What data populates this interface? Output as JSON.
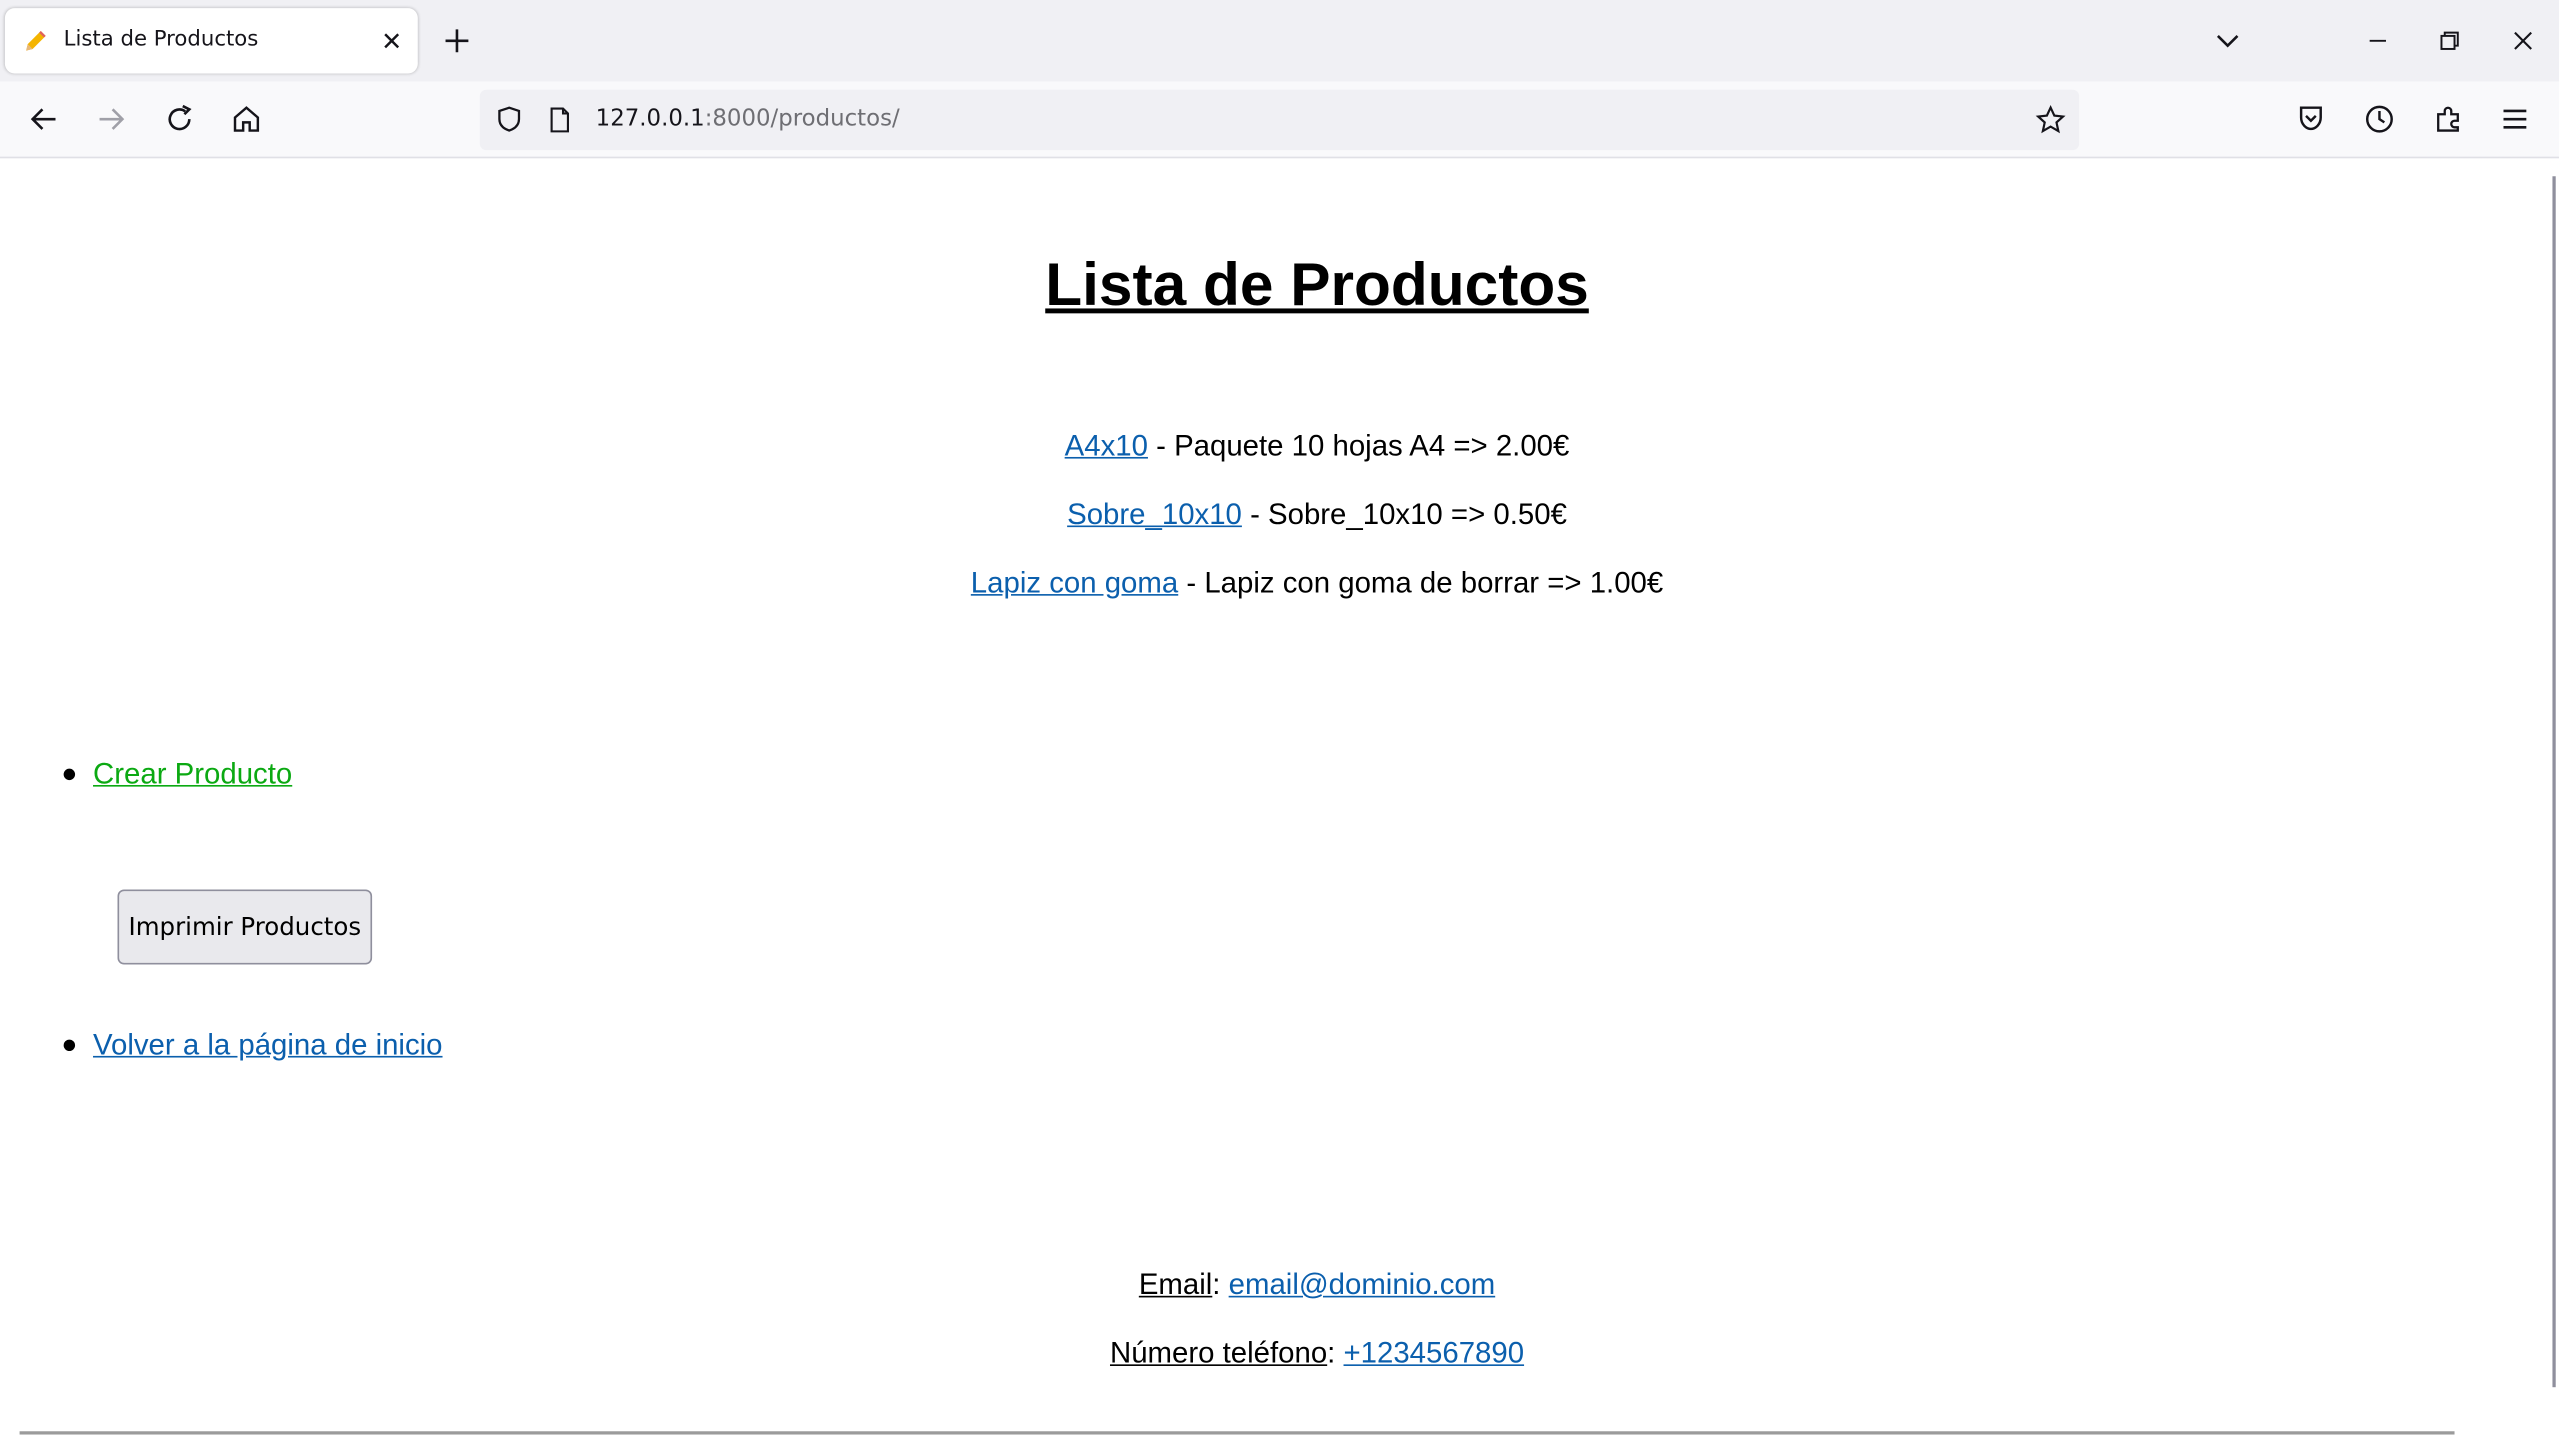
{
  "browser": {
    "tab_title": "Lista de Productos",
    "url_host": "127.0.0.1",
    "url_rest": ":8000/productos/"
  },
  "page": {
    "title": "Lista de Productos",
    "products": [
      {
        "link": "A4x10",
        "desc": " - Paquete 10 hojas A4 => 2.00€"
      },
      {
        "link": "Sobre_10x10",
        "desc": " - Sobre_10x10 => 0.50€"
      },
      {
        "link": "Lapiz con goma",
        "desc": " - Lapiz con goma de borrar => 1.00€"
      }
    ],
    "create_link": "Crear Producto",
    "print_button": "Imprimir Productos",
    "back_link": "Volver a la página de inicio",
    "footer": {
      "email_label": "Email",
      "email_value": "email@dominio.com",
      "phone_label": "Número teléfono",
      "phone_value": "+1234567890"
    }
  },
  "colors": {
    "link": "#0b5fad",
    "create_link": "#0ba912"
  }
}
